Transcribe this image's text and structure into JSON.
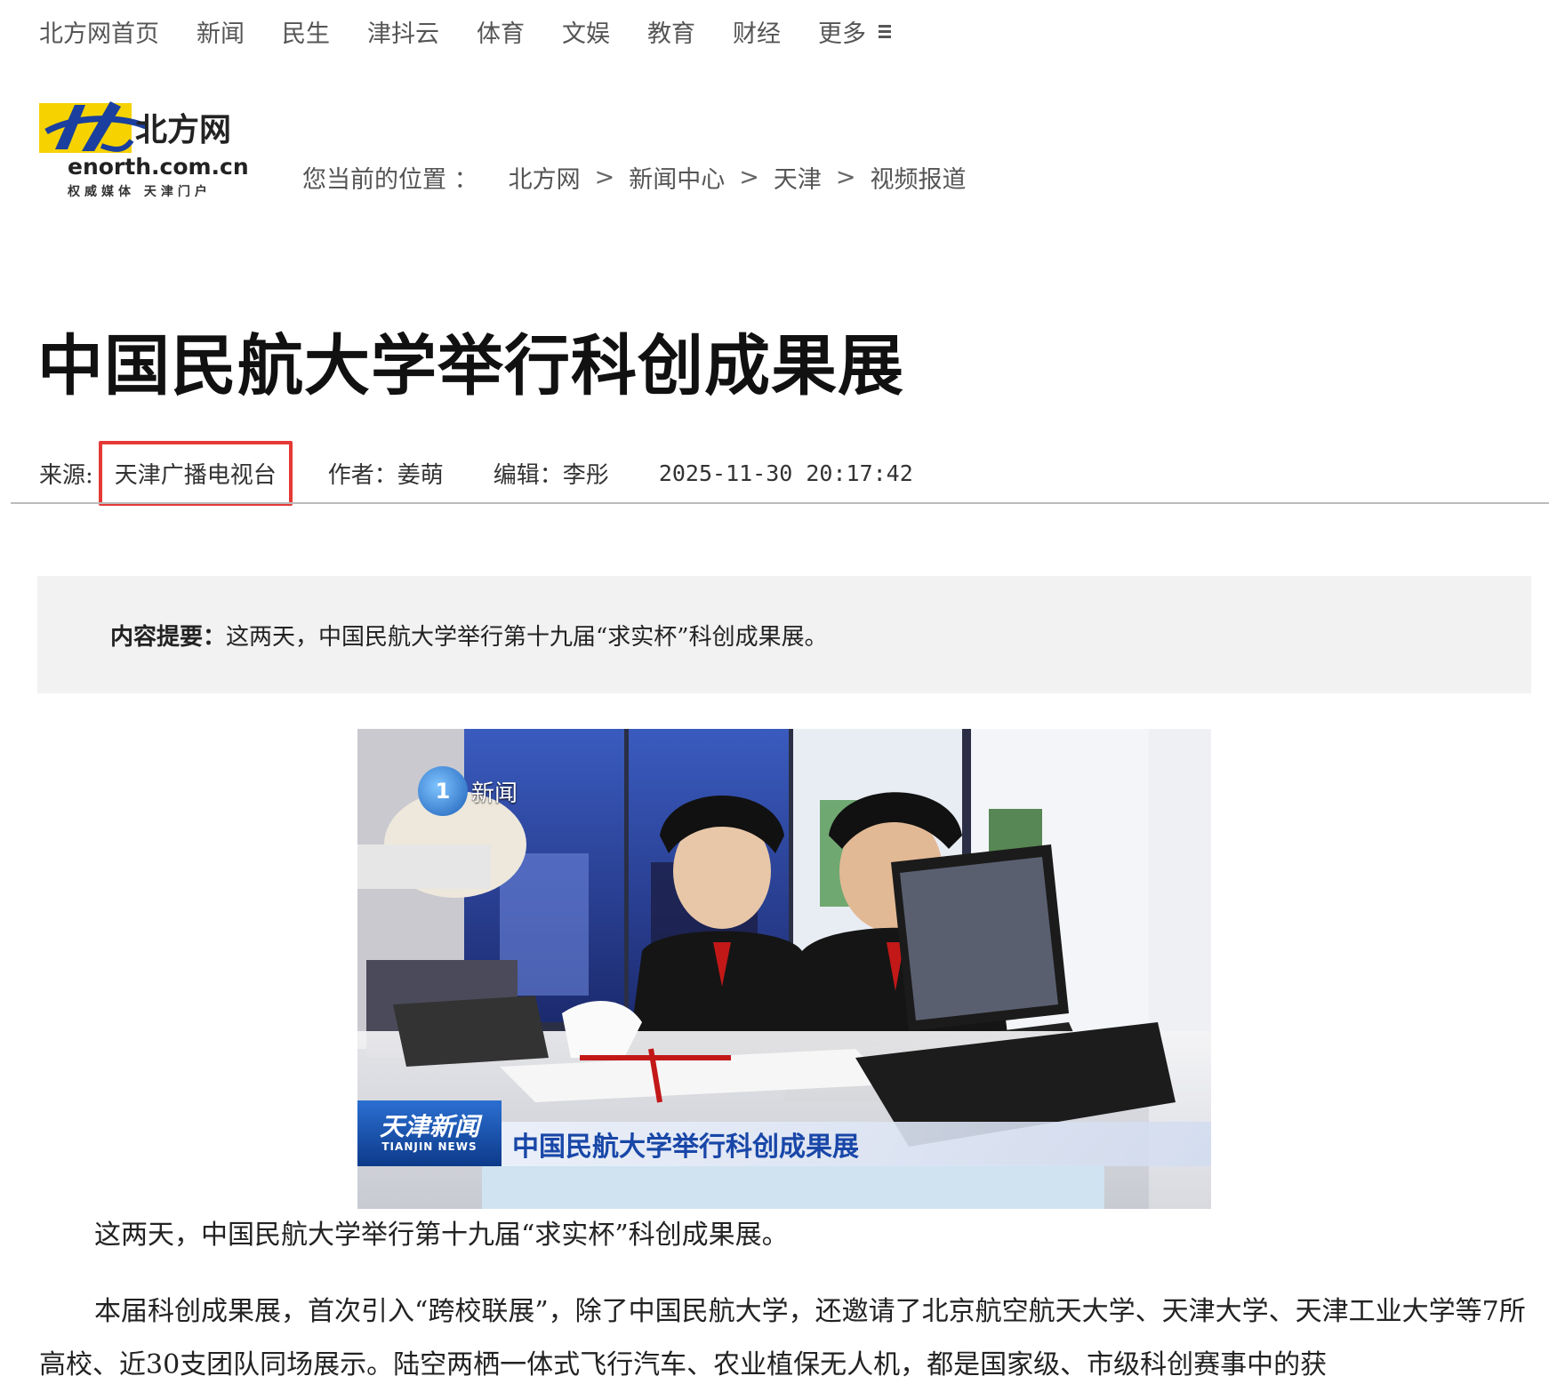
{
  "nav": {
    "items": [
      "北方网首页",
      "新闻",
      "民生",
      "津抖云",
      "体育",
      "文娱",
      "教育",
      "财经"
    ],
    "more": "更多"
  },
  "logo": {
    "name": "北方网",
    "domain": "enorth.com.cn",
    "tagline": "权威媒体 天津门户"
  },
  "breadcrumb": {
    "label": "您当前的位置 ：",
    "items": [
      "北方网",
      "新闻中心",
      "天津",
      "视频报道"
    ]
  },
  "article": {
    "title": "中国民航大学举行科创成果展",
    "source_label": "来源:",
    "source": "天津广播电视台",
    "author": "作者：姜萌",
    "editor": "编辑：李彤",
    "date": "2025-11-30 20:17:42",
    "summary_label": "内容提要：",
    "summary": "这两天，中国民航大学举行第十九届“求实杯”科创成果展。",
    "paragraphs": [
      "这两天，中国民航大学举行第十九届“求实杯”科创成果展。",
      "本届科创成果展，首次引入“跨校联展”，除了中国民航大学，还邀请了北京航空航天大学、天津大学、天津工业大学等7所高校、近30支团队同场展示。陆空两栖一体式飞行汽车、农业植保无人机，都是国家级、市级科创赛事中的获"
    ]
  },
  "video": {
    "channel_badge": "1",
    "channel_text": "新闻",
    "program_cn": "天津新闻",
    "program_en": "TIANJIN NEWS",
    "caption": "中国民航大学举行科创成果展"
  },
  "colors": {
    "highlight_border": "#e53935",
    "summary_bg": "#f2f2f2",
    "caption_text": "#1947a8"
  }
}
